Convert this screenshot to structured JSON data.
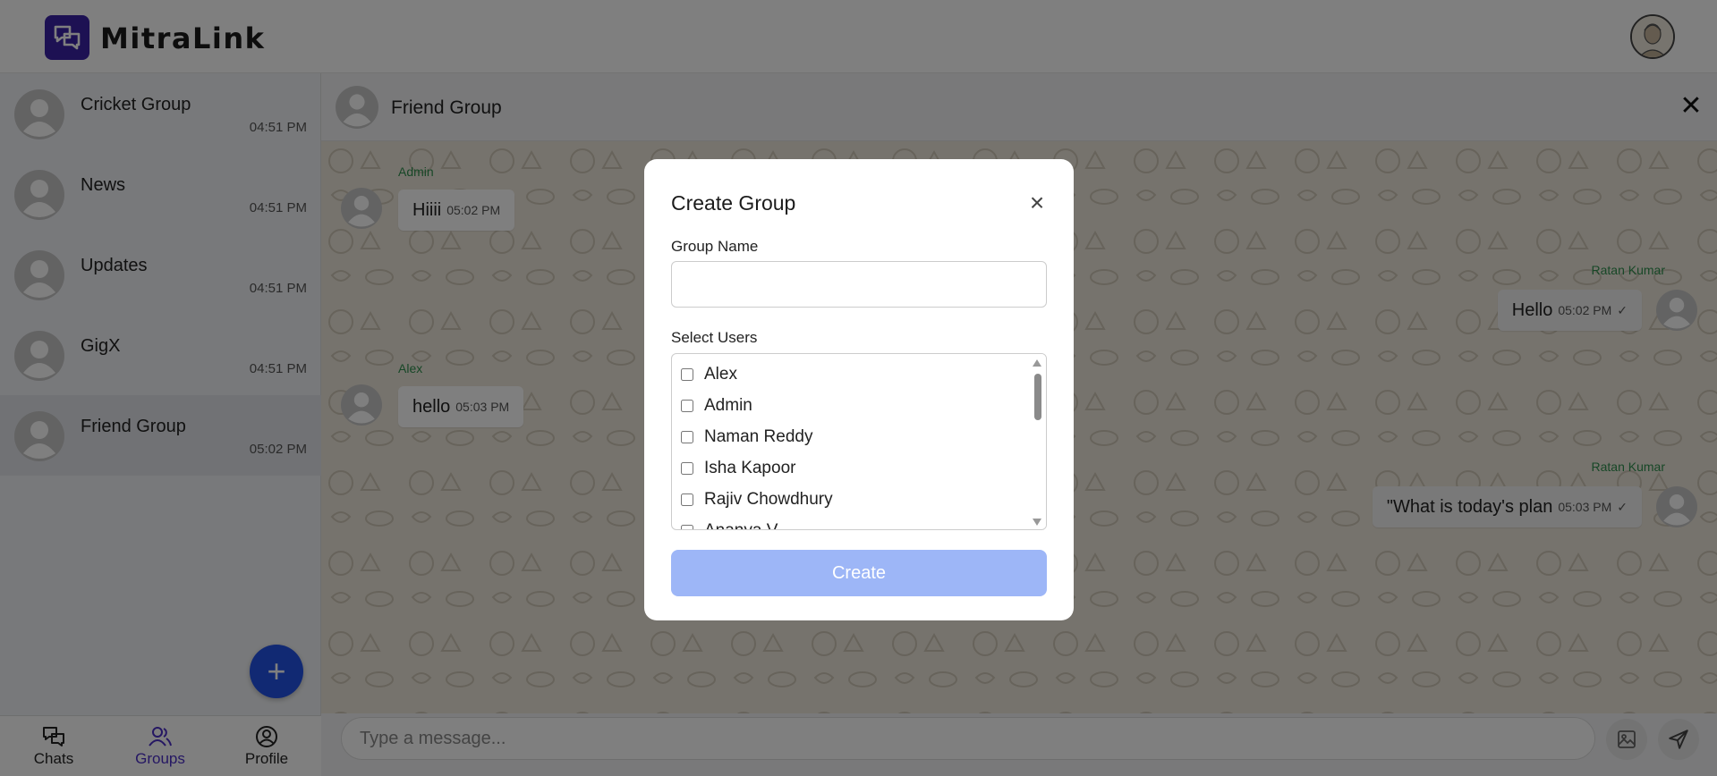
{
  "app": {
    "name": "MitraLink"
  },
  "sidebar": {
    "chats": [
      {
        "name": "Cricket Group",
        "time": "04:51 PM"
      },
      {
        "name": "News",
        "time": "04:51 PM"
      },
      {
        "name": "Updates",
        "time": "04:51 PM"
      },
      {
        "name": "GigX",
        "time": "04:51 PM"
      },
      {
        "name": "Friend Group",
        "time": "05:02 PM",
        "active": true
      }
    ],
    "fab_label": "+"
  },
  "bottom_nav": [
    {
      "label": "Chats",
      "icon": "chats-icon"
    },
    {
      "label": "Groups",
      "icon": "groups-icon",
      "active": true
    },
    {
      "label": "Profile",
      "icon": "profile-icon"
    }
  ],
  "chat": {
    "title": "Friend Group",
    "messages": [
      {
        "sender": "Admin",
        "text": "Hiiii",
        "time": "05:02 PM",
        "outgoing": false
      },
      {
        "sender": "Ratan Kumar",
        "text": "Hello",
        "time": "05:02 PM",
        "outgoing": true,
        "tick": "✓"
      },
      {
        "sender": "Alex",
        "text": "hello",
        "time": "05:03 PM",
        "outgoing": false
      },
      {
        "sender": "Ratan Kumar",
        "text": "\"What is today's plan",
        "time": "05:03 PM",
        "outgoing": true,
        "tick": "✓"
      }
    ],
    "composer": {
      "placeholder": "Type a message..."
    }
  },
  "modal": {
    "title": "Create Group",
    "group_name_label": "Group Name",
    "group_name_value": "",
    "select_users_label": "Select Users",
    "users": [
      "Alex",
      "Admin",
      "Naman Reddy",
      "Isha Kapoor",
      "Rajiv Chowdhury",
      "Ananya V"
    ],
    "create_label": "Create",
    "close_label": "×"
  },
  "colors": {
    "brand": "#3b23a6",
    "fab": "#2352e6",
    "create_button": "#9db6f7",
    "sender_name": "#2f8f4e",
    "nav_active": "#4b2ec7"
  }
}
